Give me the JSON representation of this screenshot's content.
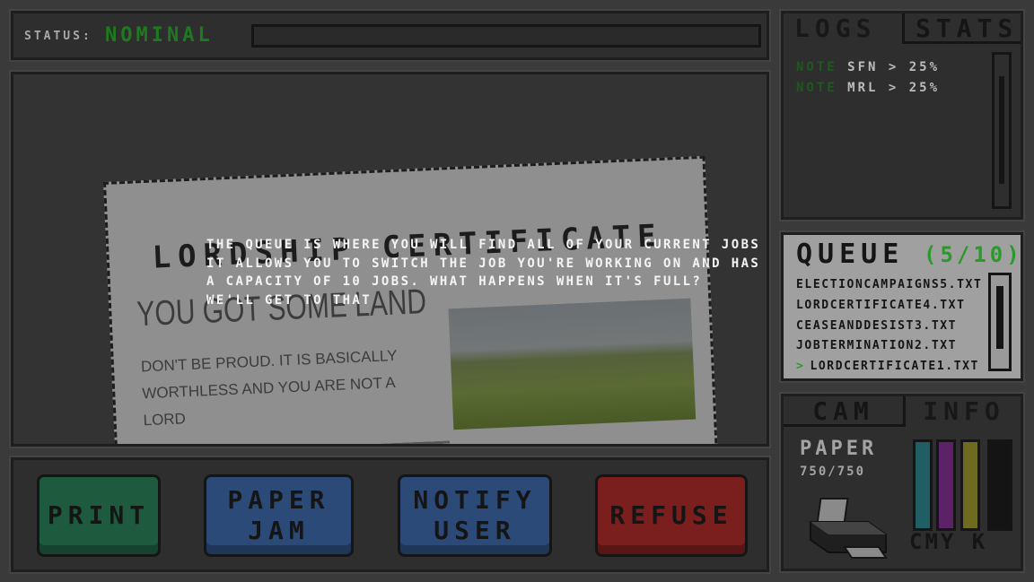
{
  "status": {
    "label": "STATUS:",
    "value": "NOMINAL"
  },
  "document": {
    "title": "LORDSHIP CERTIFICATE",
    "subtitle": "YOU GOT SOME LAND",
    "body": "DON'T BE PROUD. IT IS BASICALLY WORTHLESS AND YOU ARE NOT A LORD"
  },
  "tutorial": {
    "text": "THE QUEUE IS WHERE YOU WILL FIND ALL OF YOUR CURRENT JOBS\nIT ALLOWS YOU TO SWITCH THE JOB YOU'RE WORKING ON AND HAS\nA CAPACITY OF 10 JOBS. WHAT HAPPENS WHEN IT'S FULL?\nWE'LL GET TO THAT"
  },
  "buttons": {
    "print": "PRINT",
    "paper_jam_1": "PAPER",
    "paper_jam_2": "JAM",
    "notify_1": "NOTIFY",
    "notify_2": "USER",
    "refuse": "REFUSE"
  },
  "logs": {
    "tab_logs": "LOGS",
    "tab_stats": "STATS",
    "entries": [
      {
        "tag": "NOTE",
        "text": "SFN > 25%"
      },
      {
        "tag": "NOTE",
        "text": "MRL > 25%"
      }
    ]
  },
  "queue": {
    "title": "QUEUE",
    "count": "(5/10)",
    "files": [
      "ELECTIONCAMPAIGNS5.TXT",
      "LORDCERTIFICATE4.TXT",
      "CEASEANDDESIST3.TXT",
      "JOBTERMINATION2.TXT",
      "LORDCERTIFICATE1.TXT"
    ],
    "selected_marker": ">"
  },
  "info": {
    "tab_cam": "CAM",
    "tab_info": "INFO",
    "paper_label": "PAPER",
    "paper_count": "750/750",
    "ink_labels": "CMY K",
    "ink_levels": {
      "C": 1.0,
      "M": 1.0,
      "Y": 1.0,
      "K": 1.0
    },
    "colors": {
      "cyan": "#1f5f63",
      "magenta": "#5c2268",
      "yellow": "#6e6a1f",
      "black": "#141414",
      "accent_green": "#2a9a2a"
    }
  }
}
